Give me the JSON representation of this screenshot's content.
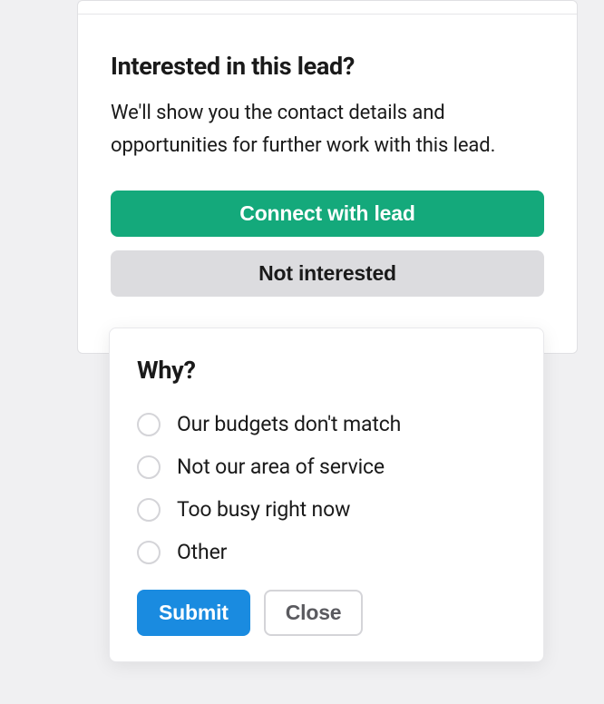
{
  "main": {
    "title": "Interested in this lead?",
    "description": "We'll show you the contact details and opportunities for further work with this lead.",
    "connect_label": "Connect with lead",
    "not_interested_label": "Not interested"
  },
  "popup": {
    "title": "Why?",
    "options": [
      "Our budgets don't match",
      "Not our area of service",
      "Too busy right now",
      "Other"
    ],
    "submit_label": "Submit",
    "close_label": "Close"
  }
}
